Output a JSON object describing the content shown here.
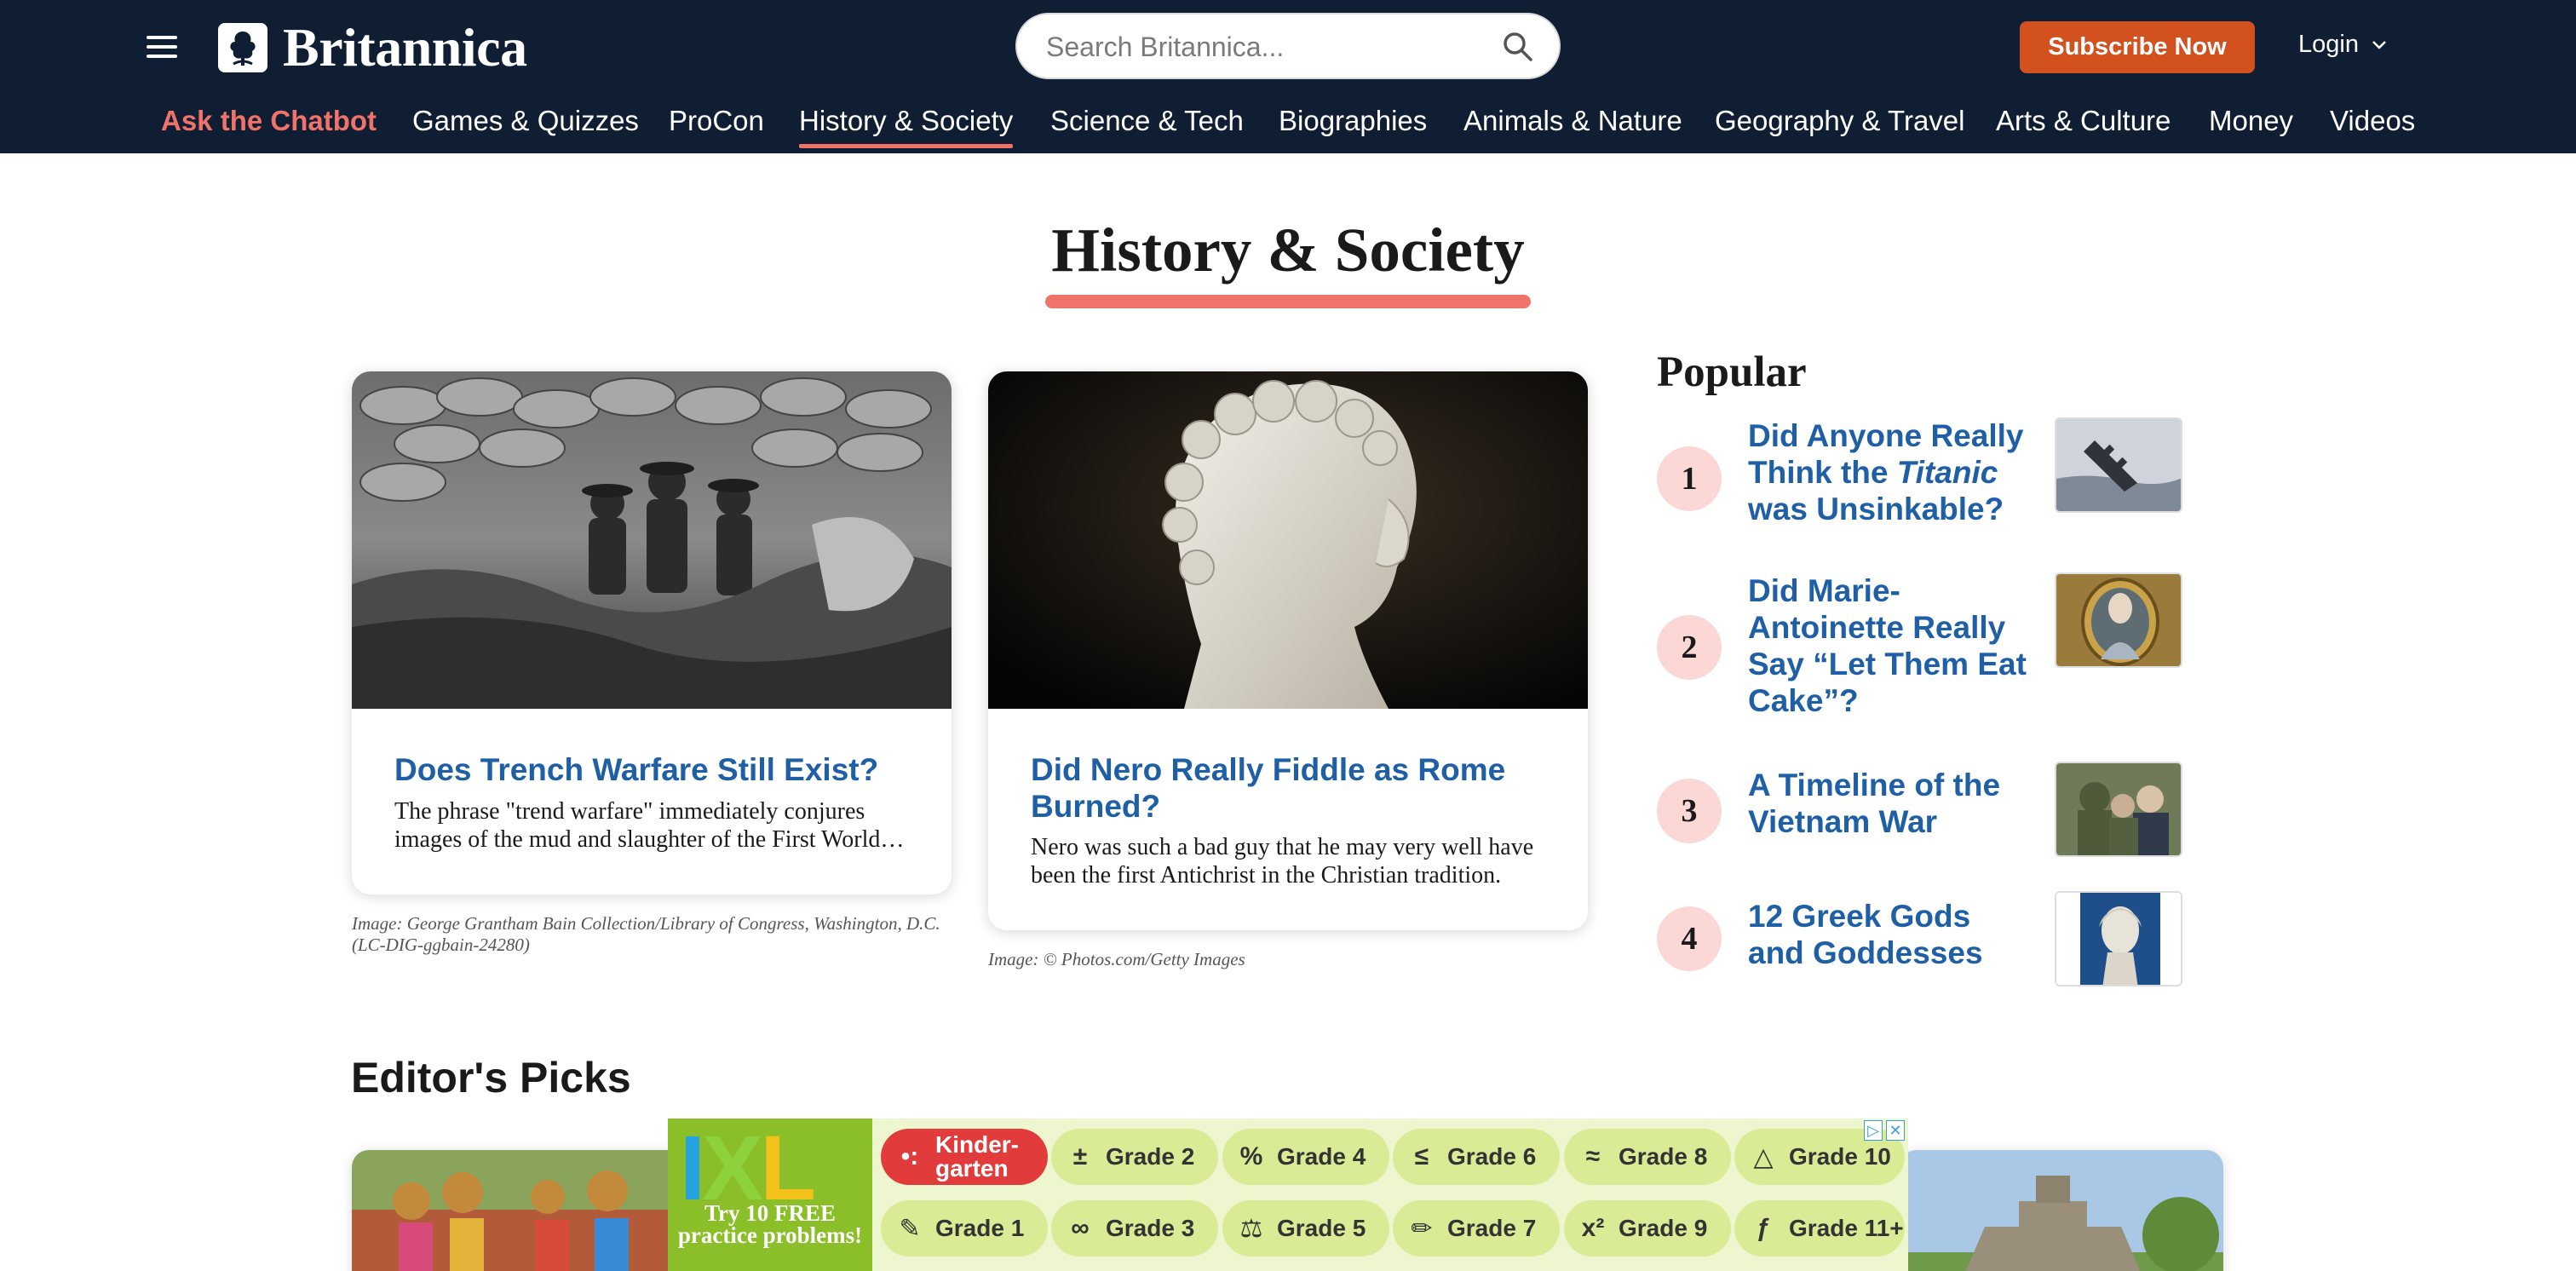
{
  "header": {
    "logo_text": "Britannica",
    "search_placeholder": "Search Britannica...",
    "subscribe_label": "Subscribe Now",
    "login_label": "Login"
  },
  "nav": {
    "items": [
      {
        "label": "Ask the Chatbot"
      },
      {
        "label": "Games & Quizzes"
      },
      {
        "label": "ProCon"
      },
      {
        "label": "History & Society"
      },
      {
        "label": "Science & Tech"
      },
      {
        "label": "Biographies"
      },
      {
        "label": "Animals & Nature"
      },
      {
        "label": "Geography & Travel"
      },
      {
        "label": "Arts & Culture"
      },
      {
        "label": "Money"
      },
      {
        "label": "Videos"
      }
    ],
    "active": "History & Society"
  },
  "page": {
    "title": "History & Society"
  },
  "cards": [
    {
      "title": "Does Trench Warfare Still Exist?",
      "excerpt": "The phrase \"trend warfare\" immediately conjures images of the mud and slaughter of the First World War.",
      "credit": "Image: George Grantham Bain Collection/Library of Congress, Washington, D.C. (LC-DIG-ggbain-24280)"
    },
    {
      "title": "Did Nero Really Fiddle as Rome Burned?",
      "excerpt": "Nero was such a bad guy that he may very well have been the first Antichrist in the Christian tradition.",
      "credit": "Image: © Photos.com/Getty Images"
    }
  ],
  "popular": {
    "heading": "Popular",
    "items": [
      {
        "rank": "1",
        "title_pre": "Did Anyone Really Think the ",
        "title_em": "Titanic",
        "title_post": " was Unsinkable?"
      },
      {
        "rank": "2",
        "title_pre": "Did Marie-Antoinette Really Say “Let Them Eat Cake”?",
        "title_em": "",
        "title_post": ""
      },
      {
        "rank": "3",
        "title_pre": "A Timeline of the Vietnam War",
        "title_em": "",
        "title_post": ""
      },
      {
        "rank": "4",
        "title_pre": "12 Greek Gods and Goddesses",
        "title_em": "",
        "title_post": ""
      }
    ]
  },
  "editors": {
    "heading": "Editor's Picks"
  },
  "ad": {
    "logo": {
      "i": "I",
      "x": "X",
      "l": "L"
    },
    "tagline": "Try 10 FREE practice problems!",
    "buttons": [
      {
        "label": "Kinder-garten",
        "icon": "dots-icon"
      },
      {
        "label": "Grade 2",
        "icon": "plus-minus-icon"
      },
      {
        "label": "Grade 4",
        "icon": "percent-icon"
      },
      {
        "label": "Grade 6",
        "icon": "less-equal-icon"
      },
      {
        "label": "Grade 8",
        "icon": "approx-icon"
      },
      {
        "label": "Grade 10",
        "icon": "triangle-icon"
      },
      {
        "label": "Grade 1",
        "icon": "pencil-cup-icon"
      },
      {
        "label": "Grade 3",
        "icon": "infinity-icon"
      },
      {
        "label": "Grade 5",
        "icon": "scale-icon"
      },
      {
        "label": "Grade 7",
        "icon": "pencil-icon"
      },
      {
        "label": "Grade 9",
        "icon": "x-squared-icon"
      },
      {
        "label": "Grade 11+",
        "icon": "function-icon"
      }
    ]
  },
  "colors": {
    "header_bg": "#0f1e33",
    "accent": "#f0736a",
    "link": "#1f5fa6",
    "subscribe": "#d3501f"
  }
}
